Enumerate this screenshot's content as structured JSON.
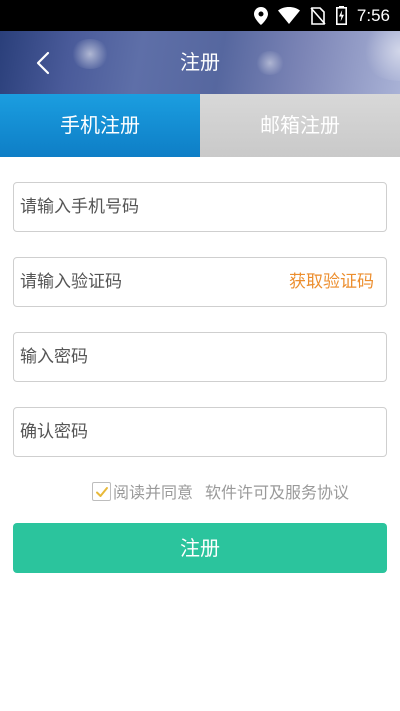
{
  "status_bar": {
    "time": "7:56",
    "icons": [
      "location-icon",
      "wifi-icon",
      "no-sim-icon",
      "battery-charging-icon"
    ]
  },
  "header": {
    "title": "注册",
    "back_icon": "back-chevron-icon"
  },
  "tabs": [
    {
      "label": "手机注册",
      "active": true
    },
    {
      "label": "邮箱注册",
      "active": false
    }
  ],
  "form": {
    "phone": {
      "placeholder": "请输入手机号码",
      "value": ""
    },
    "code": {
      "placeholder": "请输入验证码",
      "value": "",
      "get_code_label": "获取验证码"
    },
    "password": {
      "placeholder": "输入密码",
      "value": ""
    },
    "confirm": {
      "placeholder": "确认密码",
      "value": ""
    }
  },
  "agreement": {
    "checked": true,
    "text": "阅读并同意",
    "link": "软件许可及服务协议"
  },
  "submit_label": "注册",
  "colors": {
    "accent_blue": "#1b9ee0",
    "submit_green": "#2bc49d",
    "get_code_orange": "#ec8e2e"
  }
}
